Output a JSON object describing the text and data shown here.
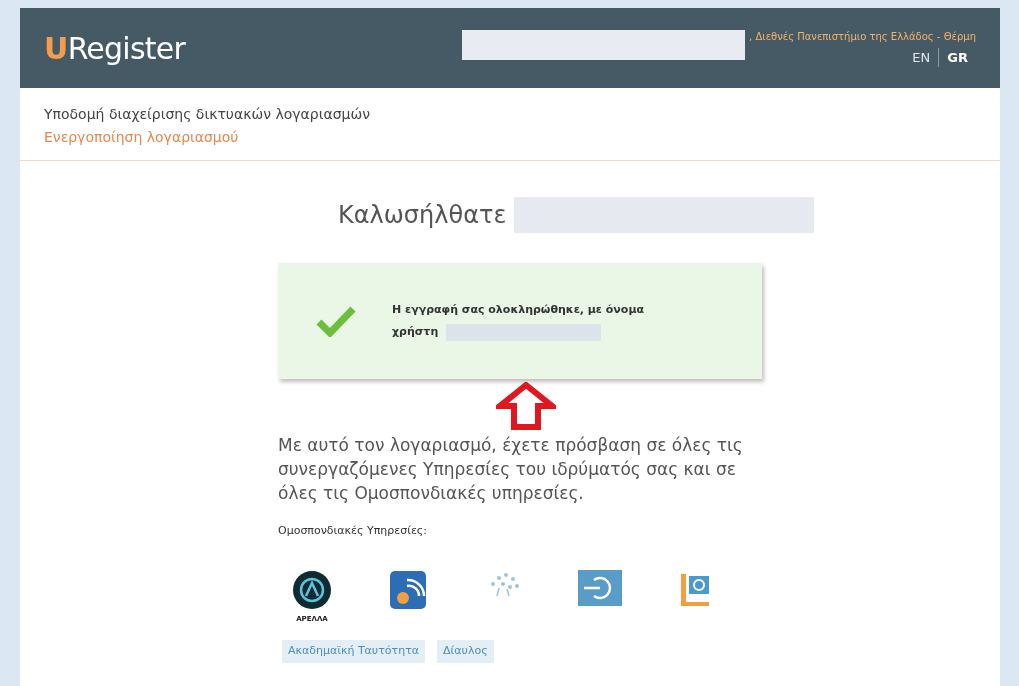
{
  "header": {
    "logo_initial": "U",
    "logo_rest": "Register",
    "institution": ", Διεθνές Πανεπιστήμιο της Ελλάδος - Θέρμη",
    "languages": [
      {
        "label": "EN",
        "selected": false
      },
      {
        "label": "GR",
        "selected": true
      }
    ]
  },
  "breadcrumb": {
    "title": "Υποδομή διαχείρισης δικτυακών λογαριασμών",
    "subtitle": "Ενεργοποίηση λογαριασμού"
  },
  "welcome": "Καλωσήλθατε",
  "success": {
    "message": "Η εγγραφή σας ολοκληρώθηκε, με όνομα",
    "username_label": "χρήστη"
  },
  "description": "Με αυτό τον λογαριασμό, έχετε πρόσβαση σε όλες τις συνεργαζόμενες Υπηρεσίες του ιδρύματός σας και σε όλες τις Ομοσπονδιακές υπηρεσίες.",
  "federated_title": "Ομοσπονδιακές Υπηρεσίες:",
  "services": [
    {
      "kind": "apella",
      "caption": "ΑΡΕΛΛΑ"
    },
    {
      "kind": "wifi"
    },
    {
      "kind": "dots"
    },
    {
      "kind": "power"
    },
    {
      "kind": "mail"
    }
  ],
  "service_links": [
    "Ακαδημαϊκή Ταυτότητα",
    "Δίαυλος"
  ]
}
